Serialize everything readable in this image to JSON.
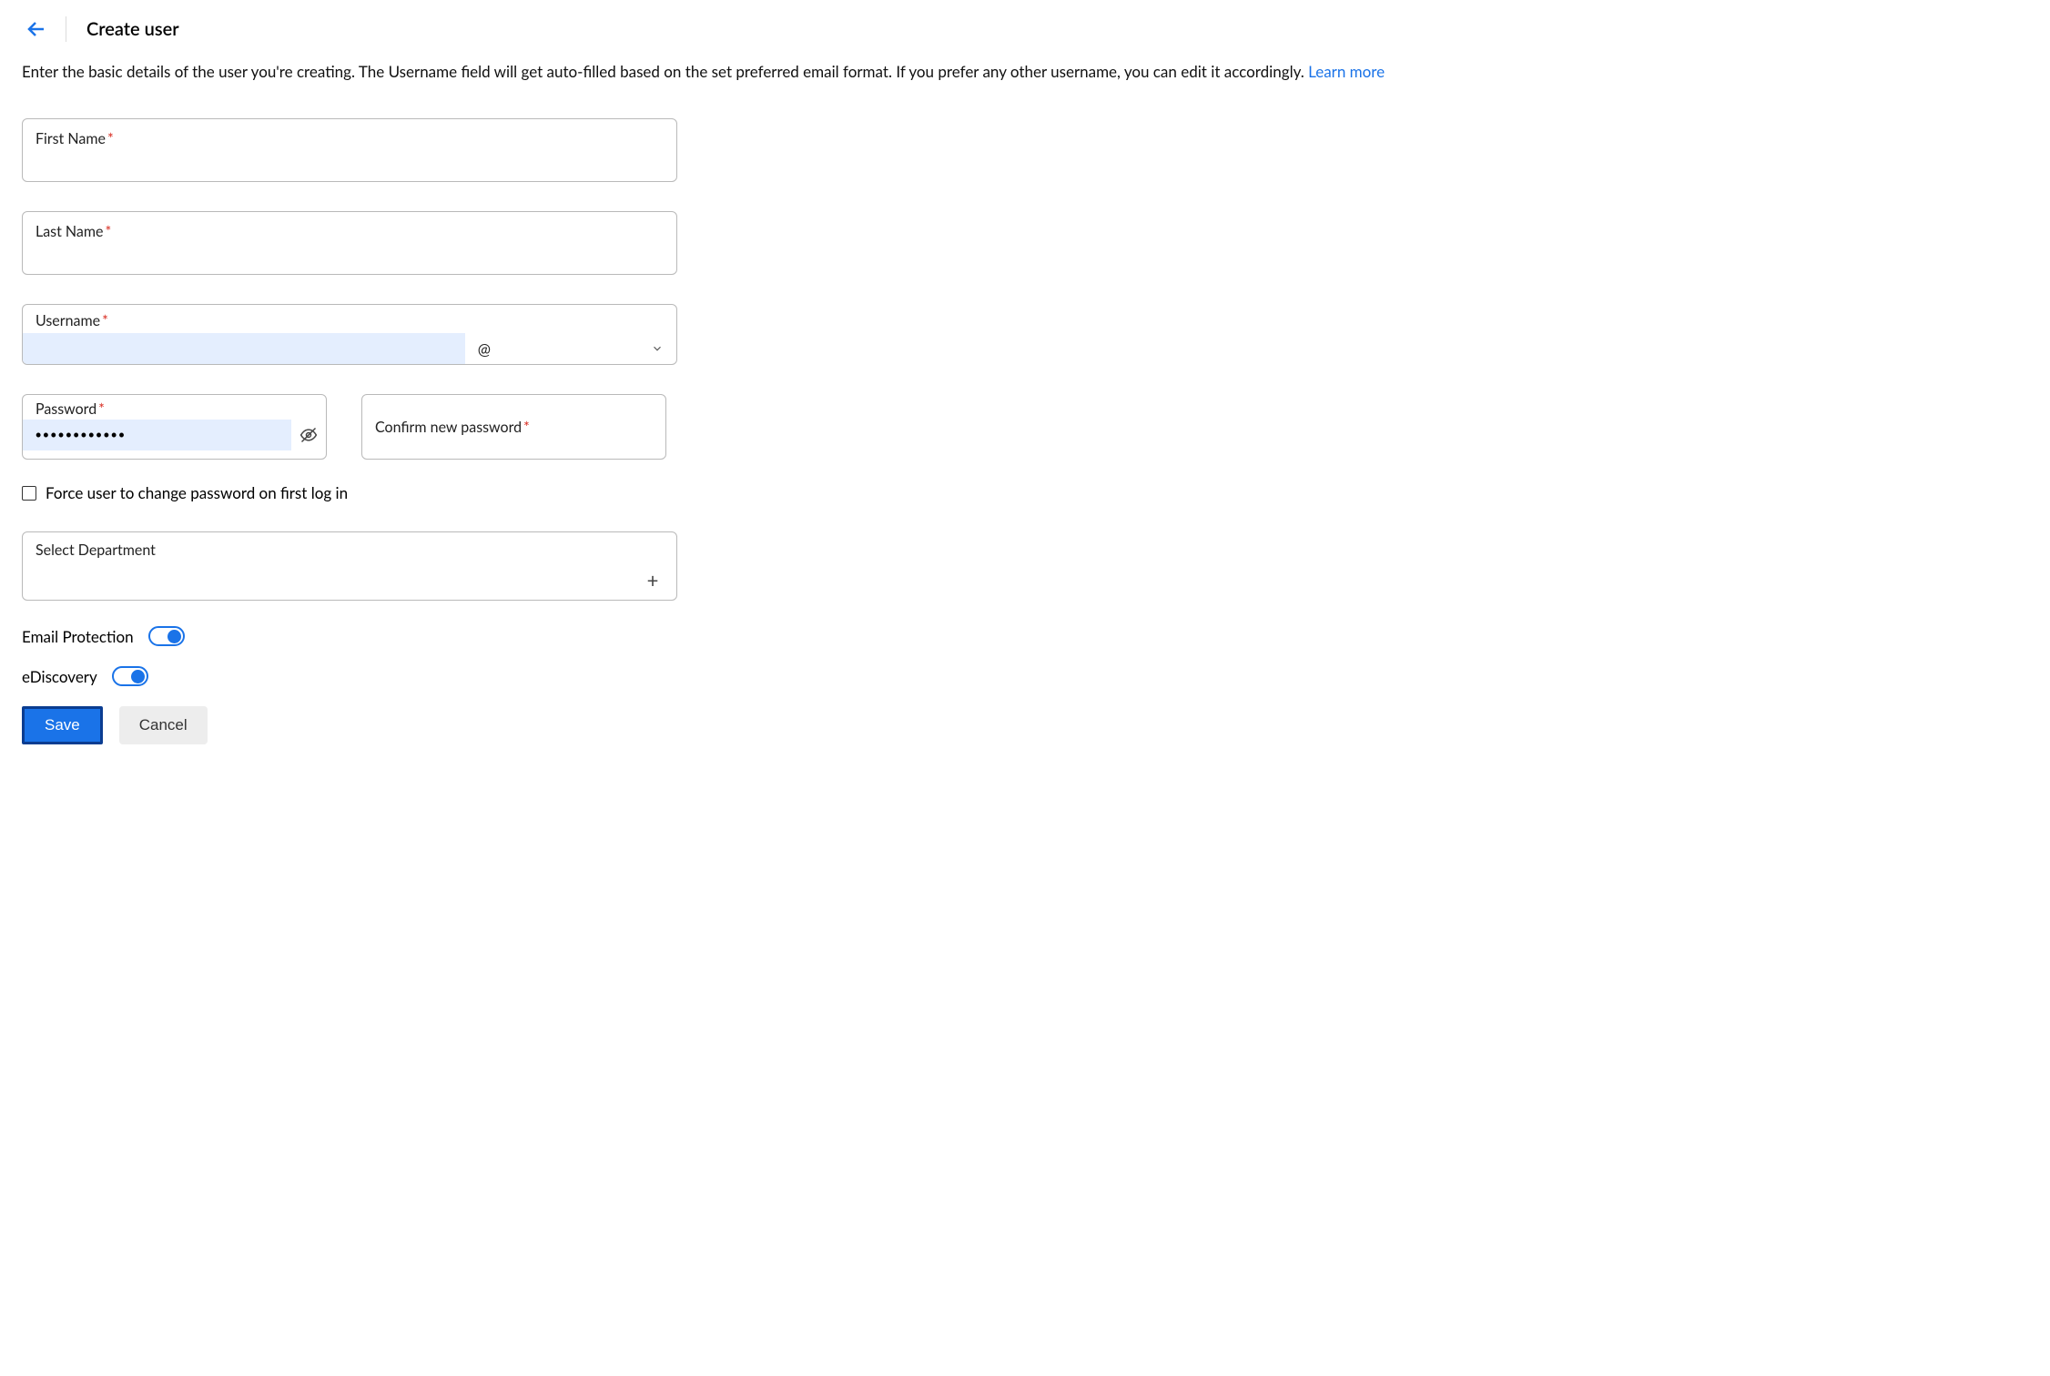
{
  "header": {
    "title": "Create user"
  },
  "intro": {
    "text": "Enter the basic details of the user you're creating. The Username field will get auto-filled based on the set preferred email format. If you prefer any other username, you can edit it accordingly. ",
    "link_text": "Learn more"
  },
  "fields": {
    "first_name": {
      "label": "First Name"
    },
    "last_name": {
      "label": "Last Name"
    },
    "username": {
      "label": "Username",
      "at": "@",
      "value": ""
    },
    "password": {
      "label": "Password",
      "value": "•••••••••••"
    },
    "confirm_password": {
      "label": "Confirm new password"
    },
    "force_change": {
      "label": "Force user to change password on first log in",
      "checked": false
    },
    "department": {
      "label": "Select Department"
    }
  },
  "toggles": {
    "email_protection": {
      "label": "Email Protection",
      "on": true
    },
    "ediscovery": {
      "label": "eDiscovery",
      "on": true
    }
  },
  "buttons": {
    "save": "Save",
    "cancel": "Cancel"
  }
}
